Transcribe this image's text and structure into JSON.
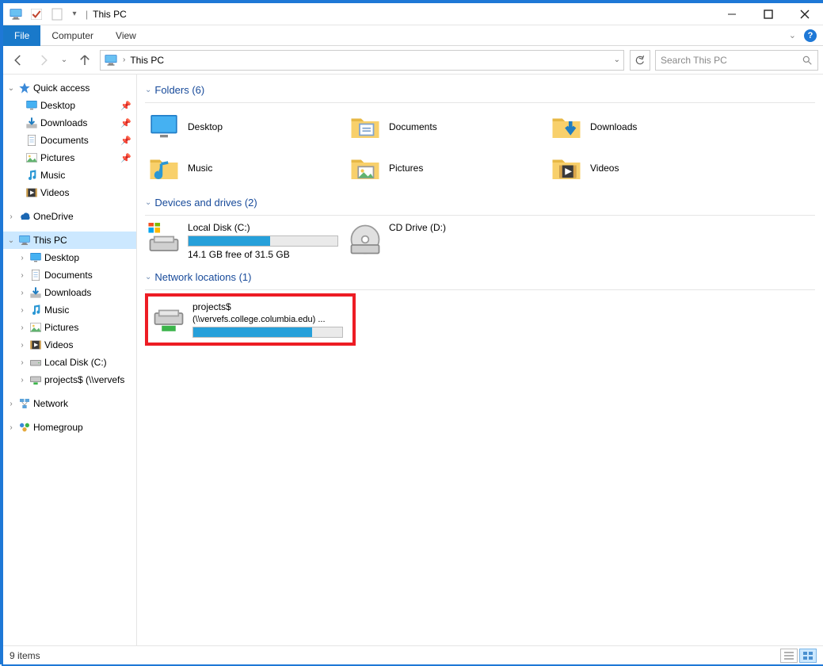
{
  "window": {
    "title": "This PC"
  },
  "ribbon": {
    "file": "File",
    "tabs": [
      "Computer",
      "View"
    ]
  },
  "nav": {
    "crumb": "This PC",
    "search_placeholder": "Search This PC"
  },
  "sidebar": {
    "quick_access": "Quick access",
    "quick_items": [
      {
        "label": "Desktop",
        "icon": "desktop"
      },
      {
        "label": "Downloads",
        "icon": "downloads"
      },
      {
        "label": "Documents",
        "icon": "documents"
      },
      {
        "label": "Pictures",
        "icon": "pictures"
      }
    ],
    "quick_items2": [
      {
        "label": "Music",
        "icon": "music"
      },
      {
        "label": "Videos",
        "icon": "videos"
      }
    ],
    "onedrive": "OneDrive",
    "this_pc": "This PC",
    "pc_items": [
      {
        "label": "Desktop",
        "icon": "desktop"
      },
      {
        "label": "Documents",
        "icon": "documents"
      },
      {
        "label": "Downloads",
        "icon": "downloads"
      },
      {
        "label": "Music",
        "icon": "music"
      },
      {
        "label": "Pictures",
        "icon": "pictures"
      },
      {
        "label": "Videos",
        "icon": "videos"
      },
      {
        "label": "Local Disk (C:)",
        "icon": "disk"
      },
      {
        "label": "projects$ (\\\\vervefs",
        "icon": "netdrive"
      }
    ],
    "network": "Network",
    "homegroup": "Homegroup"
  },
  "content": {
    "folders_header": "Folders (6)",
    "folders": [
      {
        "label": "Desktop",
        "icon": "desktop-big"
      },
      {
        "label": "Documents",
        "icon": "documents-big"
      },
      {
        "label": "Downloads",
        "icon": "downloads-big"
      },
      {
        "label": "Music",
        "icon": "music-big"
      },
      {
        "label": "Pictures",
        "icon": "pictures-big"
      },
      {
        "label": "Videos",
        "icon": "videos-big"
      }
    ],
    "drives_header": "Devices and drives (2)",
    "local_disk": {
      "name": "Local Disk (C:)",
      "free": "14.1 GB free of 31.5 GB",
      "fill_pct": 55
    },
    "cd_drive": {
      "name": "CD Drive (D:)"
    },
    "network_header": "Network locations (1)",
    "net_drive": {
      "line1": "projects$",
      "line2": "(\\\\vervefs.college.columbia.edu) ...",
      "fill_pct": 80
    }
  },
  "status": {
    "text": "9 items"
  }
}
